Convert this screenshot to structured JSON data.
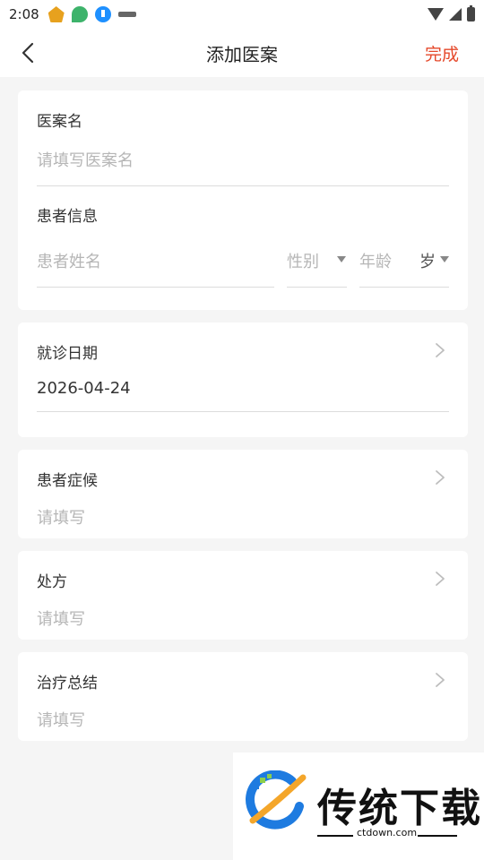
{
  "status_bar": {
    "time": "2:08",
    "icons": [
      "app-shield-icon",
      "leaf-app-icon",
      "download-app-icon",
      "mini-app-icon",
      "wifi-icon",
      "signal-icon",
      "battery-icon"
    ]
  },
  "nav": {
    "title": "添加医案",
    "done_label": "完成",
    "accent_color": "#e5492b"
  },
  "case_name": {
    "label": "医案名",
    "placeholder": "请填写医案名"
  },
  "patient_info": {
    "label": "患者信息",
    "name_placeholder": "患者姓名",
    "gender_placeholder": "性别",
    "age_placeholder": "年龄",
    "age_unit": "岁"
  },
  "visit_date": {
    "label": "就诊日期",
    "value": "2026-04-24"
  },
  "symptoms": {
    "label": "患者症候",
    "placeholder": "请填写"
  },
  "prescription": {
    "label": "处方",
    "placeholder": "请填写"
  },
  "treatment_summary": {
    "label": "治疗总结",
    "placeholder": "请填写"
  },
  "watermark": {
    "title": "传统下载",
    "subtitle": "ctdown.com"
  }
}
